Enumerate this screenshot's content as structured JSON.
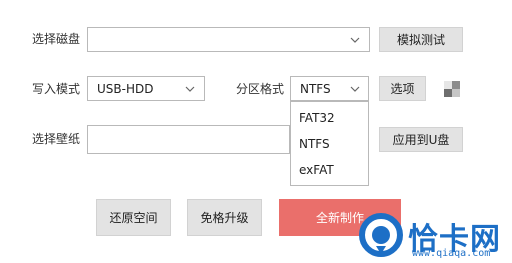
{
  "rows": {
    "disk": {
      "label": "选择磁盘",
      "value": "",
      "button": "模拟测试"
    },
    "mode": {
      "label": "写入模式",
      "value": "USB-HDD"
    },
    "partition": {
      "label": "分区格式",
      "value": "NTFS",
      "button": "选项"
    },
    "wallpaper": {
      "label": "选择壁纸",
      "value": "",
      "button": "应用到U盘"
    }
  },
  "dropdown": {
    "options": [
      "FAT32",
      "NTFS",
      "exFAT"
    ]
  },
  "actions": {
    "restore": "还原空间",
    "upgrade": "免格升级",
    "create": "全新制作"
  },
  "watermark": {
    "name": "恰卡网",
    "url": "www.qiaqa.com"
  },
  "colors": {
    "accent": "#ea6f6b",
    "logo": "#1d6fc6"
  }
}
